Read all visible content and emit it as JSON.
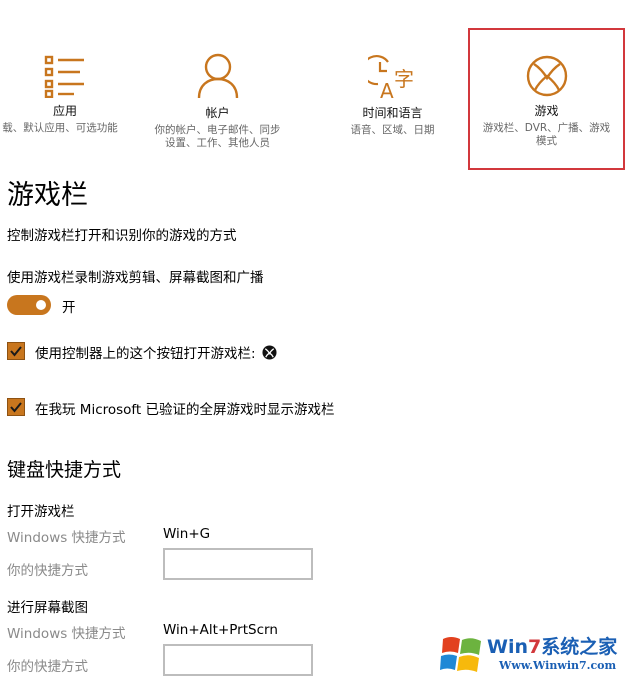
{
  "categories": [
    {
      "id": "apps",
      "icon": "apps-list-icon",
      "title": "应用",
      "subtitle_lines": [
        "载、默认应用、可选功能"
      ]
    },
    {
      "id": "accounts",
      "icon": "person-icon",
      "title": "帐户",
      "subtitle_lines": [
        "你的帐户、电子邮件、同步",
        "设置、工作、其他人员"
      ]
    },
    {
      "id": "time-language",
      "icon": "time-language-icon",
      "title": "时间和语言",
      "subtitle_lines": [
        "语音、区域、日期"
      ]
    },
    {
      "id": "gaming",
      "icon": "xbox-icon",
      "title": "游戏",
      "subtitle_lines": [
        "游戏栏、DVR、广播、游戏",
        "模式"
      ],
      "selected": true
    }
  ],
  "page": {
    "title": "游戏栏",
    "description": "控制游戏栏打开和识别你的游戏的方式"
  },
  "record": {
    "label": "使用游戏栏录制游戏剪辑、屏幕截图和广播",
    "toggle_state": "开",
    "toggle_on": true
  },
  "options": [
    {
      "label": "使用控制器上的这个按钮打开游戏栏:",
      "checked": true,
      "trailing_icon": "xbox-icon"
    },
    {
      "label": "在我玩 Microsoft 已验证的全屏游戏时显示游戏栏",
      "checked": true
    }
  ],
  "shortcuts": {
    "heading": "键盘快捷方式",
    "groups": [
      {
        "title": "打开游戏栏",
        "windows_label": "Windows 快捷方式",
        "windows_value": "Win+G",
        "custom_label": "你的快捷方式",
        "custom_value": ""
      },
      {
        "title": "进行屏幕截图",
        "windows_label": "Windows 快捷方式",
        "windows_value": "Win+Alt+PrtScrn",
        "custom_label": "你的快捷方式",
        "custom_value": ""
      }
    ]
  },
  "watermark": {
    "brand_prefix": "Win",
    "brand_seven": "7",
    "brand_suffix": "系统之家",
    "url": "Www.Winwin7.com"
  },
  "colors": {
    "accent": "#c8761e",
    "selection_border": "#d2383c",
    "muted_text": "#8a8a8a"
  }
}
